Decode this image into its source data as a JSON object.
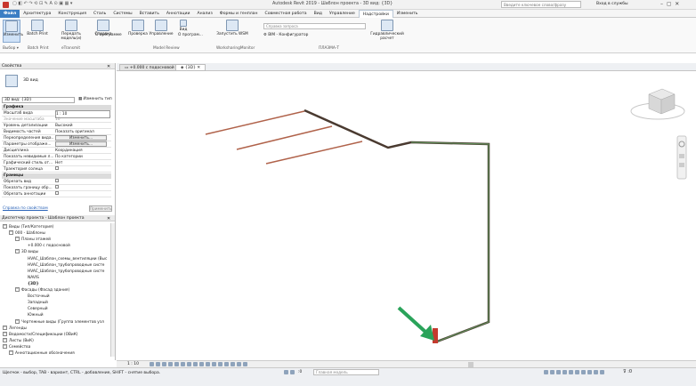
{
  "window": {
    "title": "Autodesk Revit 2019 - Шаблон проекта - 3D вид: {3D}",
    "search_placeholder": "Введите ключевое слово/фразу",
    "user": "Вход в службы"
  },
  "menu": [
    "Файл",
    "Архитектура",
    "Конструкция",
    "Сталь",
    "Системы",
    "Вставить",
    "Аннотации",
    "Анализ",
    "Формы и генплан",
    "Совместная работа",
    "Вид",
    "Управление",
    "Надстройки",
    "Изменить"
  ],
  "menu_active": 12,
  "ribbon": {
    "buttons": [
      {
        "label": "Изменить"
      },
      {
        "label": "Batch Print"
      },
      {
        "label": "Передать модель(и)"
      },
      {
        "label": "Справка"
      },
      {
        "label": "О программе"
      },
      {
        "label": "Проверка"
      },
      {
        "label": "Управление"
      },
      {
        "label": "Вид"
      },
      {
        "label": "О програм..."
      },
      {
        "label": "Запустить WSM"
      },
      {
        "label": "BIM - Конфигуратор"
      },
      {
        "label": "Гидравлический расчет"
      }
    ],
    "search_placeholder": "Справка запроса",
    "groups": [
      "Выбор ▾",
      "Batch Print",
      "eTransmit",
      "Model Review",
      "WorksharingMonitor",
      "ПЛАЗМА-Т"
    ]
  },
  "properties": {
    "panel_title": "Свойства",
    "type_name": "3D вид",
    "instance_selector": "3D вид: {3D}",
    "edit_type": "Изменить тип",
    "section_graphics": "Графика",
    "rows": [
      {
        "k": "Масштаб вида",
        "v": "1 : 10"
      },
      {
        "k": "Значение масштаба",
        "v": "10"
      },
      {
        "k": "Уровень детализации",
        "v": "Высокий"
      },
      {
        "k": "Видимость частей",
        "v": "Показать оригинал"
      },
      {
        "k": "Переопределения вида...",
        "v": "Изменить..."
      },
      {
        "k": "Параметры отображе...",
        "v": "Изменить..."
      },
      {
        "k": "Дисциплина",
        "v": "Координация"
      },
      {
        "k": "Показать невидимые л...",
        "v": "По категории"
      },
      {
        "k": "Графический стиль от...",
        "v": "Нет"
      },
      {
        "k": "Траектория солнца",
        "v": ""
      }
    ],
    "section_extents": "Границы",
    "extents": [
      {
        "k": "Обрезать вид"
      },
      {
        "k": "Показать границу обр..."
      },
      {
        "k": "Обрезать аннотации"
      }
    ],
    "help_link": "Справка по свойствам",
    "apply": "Применить"
  },
  "browser": {
    "title": "Диспетчер проекта - Шаблон проекта",
    "items": [
      {
        "t": "Виды (Тип/Категория)",
        "lvl": 0
      },
      {
        "t": "000 - Шаблоны",
        "lvl": 1
      },
      {
        "t": "Планы этажей",
        "lvl": 2
      },
      {
        "t": "+0.000 с подосновой",
        "lvl": 3
      },
      {
        "t": "3D виды",
        "lvl": 2
      },
      {
        "t": "HVAC_Шаблон_схемы_вентиляции (Выс",
        "lvl": 3
      },
      {
        "t": "HVAC_Шаблон_трубопроводные систе",
        "lvl": 3
      },
      {
        "t": "HVAC_Шаблон_трубопроводные систе",
        "lvl": 3
      },
      {
        "t": "NAVIS",
        "lvl": 3
      },
      {
        "t": "{3D}",
        "lvl": 3
      },
      {
        "t": "Фасады (Фасад здания)",
        "lvl": 2
      },
      {
        "t": "Восточный",
        "lvl": 3
      },
      {
        "t": "Западный",
        "lvl": 3
      },
      {
        "t": "Северный",
        "lvl": 3
      },
      {
        "t": "Южный",
        "lvl": 3
      },
      {
        "t": "Чертежные виды (Группа элементов узл",
        "lvl": 2
      },
      {
        "t": "Легенды",
        "lvl": 0
      },
      {
        "t": "Ведомости/Спецификации (ОВиК)",
        "lvl": 0
      },
      {
        "t": "Листы (ВиК)",
        "lvl": 0
      },
      {
        "t": "Семейства",
        "lvl": 0
      },
      {
        "t": "Аннотационные обозначения",
        "lvl": 1
      }
    ]
  },
  "viewtabs": [
    "+0.000 с подосновой",
    "{3D}"
  ],
  "viewbar": {
    "scale": "1 : 10"
  },
  "status": {
    "hint": "Щелчок - выбор, TAB - вариант, CTRL - добавление, SHIFT - снятие выбора.",
    "model": "Главная модель",
    "counter": ":0"
  },
  "colors": {
    "pipe_red": "#b0624a",
    "pipe_dark": "#4a3a30",
    "pipe_green": "#5f8c58",
    "arrow": "#2aa35a",
    "accent": "#3c7ec4"
  }
}
